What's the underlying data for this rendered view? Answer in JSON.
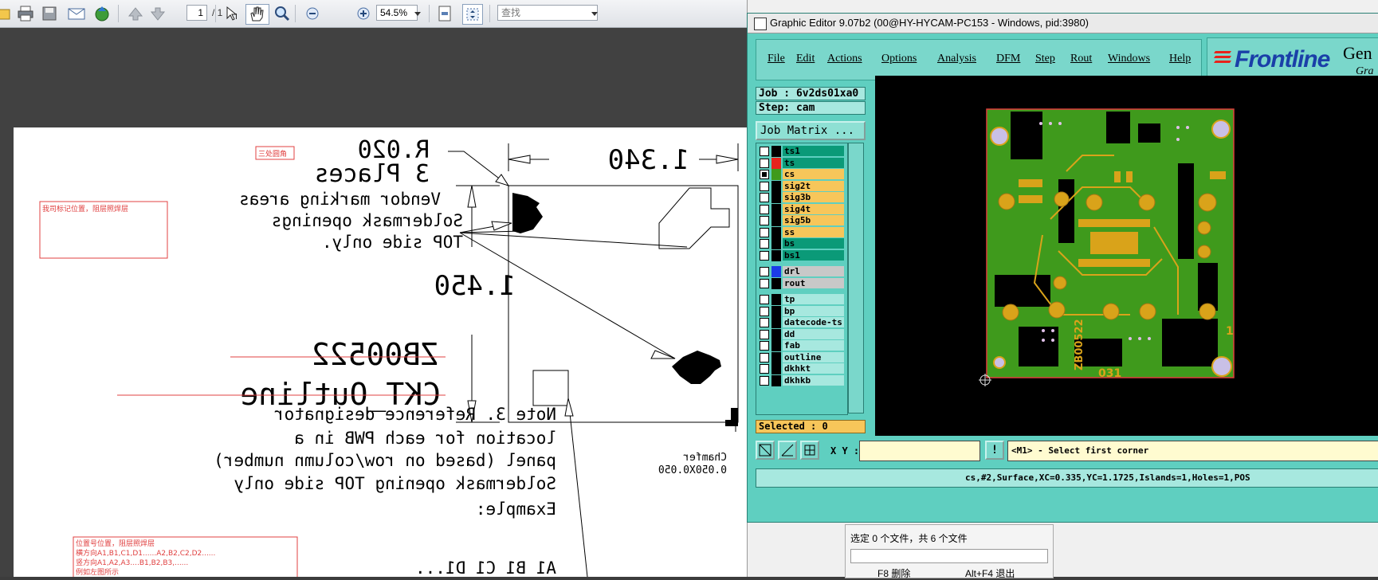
{
  "pdf_toolbar": {
    "page_current": "1",
    "page_total": "/ 1",
    "zoom": "54.5%",
    "search_placeholder": "查找"
  },
  "drawing": {
    "radius_label": "R.020",
    "radius_places": "3 Places",
    "width_dim": "1.340",
    "height_dim": "1.450",
    "vendor_lines": [
      "Vendor marking areas",
      "Soldermask openings",
      "TOP side only."
    ],
    "part_number": "ZB00522",
    "outline_label": "CKT_Outline",
    "note_lines": [
      "Note 3. Reference designator",
      "location for each PWB in a",
      "panel (based on row/column number)",
      "Soldermask opening TOP side only"
    ],
    "example_lines": [
      "Example:",
      "A1  B1  C1  D1..."
    ],
    "chamfer_lines": [
      "Chamfer",
      "0.050X0.050"
    ],
    "annot_corner": "三处圆角",
    "annot_mark": "我司标记位置，阻层照焊层",
    "annot_ref": [
      "位置号位置，阻层照焊层",
      "横方向A1,B1,C1,D1......A2,B2,C2,D2......",
      "竖方向A1,A2,A3....B1,B2,B3,......",
      "例如左图所示"
    ]
  },
  "bg_window": {
    "status": "选定 0 个文件，共 6 个文件",
    "btn_delete": "F8 删除",
    "btn_exit": "Alt+F4 退出"
  },
  "graphic_editor": {
    "title": "Graphic Editor 9.07b2 (00@HY-HYCAM-PC153 - Windows, pid:3980)",
    "menu": [
      "File",
      "Edit",
      "Actions",
      "Options",
      "Analysis",
      "DFM",
      "Step",
      "Rout",
      "Windows",
      "Help"
    ],
    "logo": "Frontline",
    "logo_gen": "Gen",
    "logo_gra": "Gra",
    "job": "Job : 6v2ds01xa0",
    "step": "Step: cam",
    "job_matrix": "Job Matrix ...",
    "layers": [
      {
        "name": "ts1",
        "color": "#0b9a78",
        "swatch": "#000000",
        "checked": false
      },
      {
        "name": "ts",
        "color": "#0b9a78",
        "swatch": "#e8231c",
        "checked": false
      },
      {
        "name": "cs",
        "color": "#f7c65a",
        "swatch": "#3f9a1c",
        "checked": true
      },
      {
        "name": "sig2t",
        "color": "#f7c65a",
        "swatch": "#000000",
        "checked": false
      },
      {
        "name": "sig3b",
        "color": "#f7c65a",
        "swatch": "#000000",
        "checked": false
      },
      {
        "name": "sig4t",
        "color": "#f7c65a",
        "swatch": "#000000",
        "checked": false
      },
      {
        "name": "sig5b",
        "color": "#f7c65a",
        "swatch": "#000000",
        "checked": false
      },
      {
        "name": "ss",
        "color": "#f7c65a",
        "swatch": "#000000",
        "checked": false
      },
      {
        "name": "bs",
        "color": "#0b9a78",
        "swatch": "#000000",
        "checked": false
      },
      {
        "name": "bs1",
        "color": "#0b9a78",
        "swatch": "#000000",
        "checked": false
      },
      {
        "name": "drl",
        "color": "#c8c8c8",
        "swatch": "#1c3ce8",
        "checked": false
      },
      {
        "name": "rout",
        "color": "#c8c8c8",
        "swatch": "#000000",
        "checked": false
      },
      {
        "name": "tp",
        "color": "#a7e8df",
        "swatch": "#000000",
        "checked": false
      },
      {
        "name": "bp",
        "color": "#a7e8df",
        "swatch": "#000000",
        "checked": false
      },
      {
        "name": "datecode-ts",
        "color": "#a7e8df",
        "swatch": "#000000",
        "checked": false
      },
      {
        "name": "dd",
        "color": "#a7e8df",
        "swatch": "#000000",
        "checked": false
      },
      {
        "name": "fab",
        "color": "#a7e8df",
        "swatch": "#000000",
        "checked": false
      },
      {
        "name": "outline",
        "color": "#a7e8df",
        "swatch": "#000000",
        "checked": false
      },
      {
        "name": "dkhkt",
        "color": "#a7e8df",
        "swatch": "#000000",
        "checked": false
      },
      {
        "name": "dkhkb",
        "color": "#a7e8df",
        "swatch": "#000000",
        "checked": false
      }
    ],
    "selected": "Selected : 0",
    "xy_label": "X Y :",
    "xy_value": "",
    "prompt": "<M1> - Select first corner",
    "status": "cs,#2,Surface,XC=0.335,YC=1.1725,Islands=1,Holes=1,POS",
    "pcb_text": [
      "ZB00522",
      "031",
      "1"
    ]
  }
}
